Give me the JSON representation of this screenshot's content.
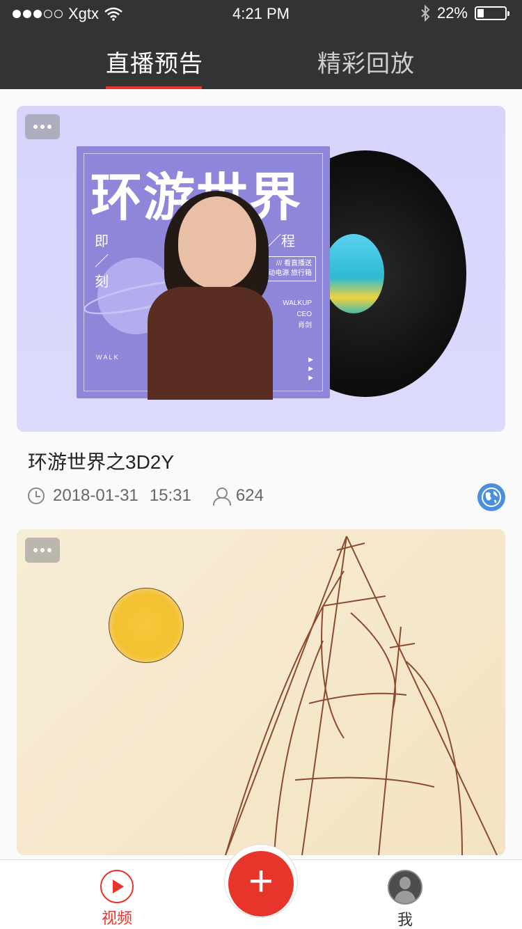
{
  "status_bar": {
    "carrier": "Xgtx",
    "time": "4:21 PM",
    "battery": "22%",
    "signal_bars": 3,
    "signal_total": 5
  },
  "tabs": [
    {
      "label": "直播预告",
      "active": true
    },
    {
      "label": "精彩回放",
      "active": false
    }
  ],
  "cards": [
    {
      "cover": {
        "title": "环游世界",
        "subtitle_lead": "即／刻",
        "subtitle_tail": "启／程",
        "box_lines": [
          "///  看直播送",
          "移动电源 旅行箱"
        ],
        "credits": [
          "WALKUP",
          "CEO",
          "肖剑"
        ],
        "wakl": "W A L K"
      },
      "title": "环游世界之3D2Y",
      "date": "2018-01-31",
      "time": "15:31",
      "viewers": "624",
      "globe_icon": "globe-icon"
    },
    {
      "cover": {}
    }
  ],
  "bottom_nav": {
    "video_label": "视频",
    "me_label": "我",
    "add_icon": "plus-icon"
  },
  "colors": {
    "accent": "#e8352b",
    "header_bg": "#333333",
    "globe": "#4a8fdc"
  }
}
